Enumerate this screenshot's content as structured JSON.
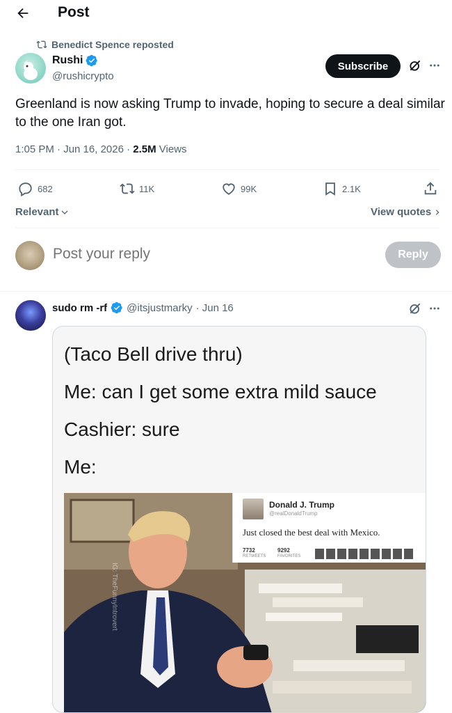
{
  "header": {
    "title": "Post"
  },
  "repost": {
    "label": "Benedict Spence reposted"
  },
  "post": {
    "author_name": "Rushi",
    "author_handle": "@rushicrypto",
    "subscribe_label": "Subscribe",
    "text": "Greenland is now asking Trump to invade, hoping to secure a deal similar to the one Iran got.",
    "time": "1:05 PM · Jun 16, 2026 · ",
    "views_count": "2.5M",
    "views_label": " Views"
  },
  "actions": {
    "replies": "682",
    "reposts": "11K",
    "likes": "99K",
    "bookmarks": "2.1K"
  },
  "sort": {
    "label": "Relevant",
    "view_quotes": "View quotes"
  },
  "composer": {
    "placeholder": "Post your reply",
    "reply_label": "Reply"
  },
  "reply": {
    "name": "sudo rm -rf",
    "handle": "@itsjustmarky",
    "date": "· Jun 16",
    "meme_lines": [
      "(Taco Bell drive thru)",
      "Me: can I get some extra mild sauce",
      "Cashier: sure",
      "Me:"
    ],
    "tweet_card": {
      "name": "Donald J. Trump",
      "handle": "@realDonaldTrump",
      "text": "Just closed the best deal with Mexico.",
      "retweets": "7732",
      "retweets_label": "RETWEETS",
      "favorites": "9292",
      "favorites_label": "FAVORITES"
    },
    "watermark": "IG: TheFunnyIntrovert"
  },
  "colors": {
    "verified": "#1d9bf0",
    "text": "#0f1419",
    "muted": "#536471"
  }
}
